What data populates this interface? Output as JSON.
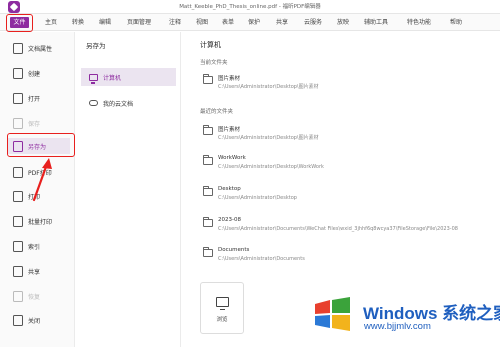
{
  "titlebar": {
    "title": "Matt_Keeble_PhD_Thesis_online.pdf - 福昕PDF编辑器"
  },
  "menu": {
    "file": "文件",
    "items": [
      "主页",
      "转换",
      "编辑",
      "页面管理",
      "注释",
      "视图",
      "表单",
      "保护",
      "共享",
      "云服务",
      "放映",
      "辅助工具",
      "特色功能",
      "帮助"
    ]
  },
  "sidebar": {
    "items": [
      {
        "label": "文档属性"
      },
      {
        "label": "创建"
      },
      {
        "label": "打开"
      },
      {
        "label": "保存"
      },
      {
        "label": "另存为"
      },
      {
        "label": "PDF打印"
      },
      {
        "label": "打印"
      },
      {
        "label": "批量打印"
      },
      {
        "label": "索引"
      },
      {
        "label": "共享"
      },
      {
        "label": "恢复"
      },
      {
        "label": "关闭"
      }
    ]
  },
  "middle": {
    "title": "另存为",
    "options": [
      {
        "label": "计算机"
      },
      {
        "label": "我的云文档"
      }
    ]
  },
  "content": {
    "title": "计算机",
    "current_folder_label": "当前文件夹",
    "recent_folder_label": "最近的文件夹",
    "current_folder": {
      "name": "图片素材",
      "path": "C:\\Users\\Administrator\\Desktop\\图片素材"
    },
    "recent_folders": [
      {
        "name": "图片素材",
        "path": "C:\\Users\\Administrator\\Desktop\\图片素材"
      },
      {
        "name": "WorkWork",
        "path": "C:\\Users\\Administrator\\Desktop\\WorkWork"
      },
      {
        "name": "Desktop",
        "path": "C:\\Users\\Administrator\\Desktop"
      },
      {
        "name": "2023-08",
        "path": "C:\\Users\\Administrator\\Documents\\WeChat Files\\wxid_3jhhf6q8wcya37\\FileStorage\\File\\2023-08"
      },
      {
        "name": "Documents",
        "path": "C:\\Users\\Administrator\\Documents"
      }
    ],
    "browse_label": "浏览"
  },
  "watermark": {
    "title": "Windows 系统之家",
    "url": "www.bjjmlv.com"
  },
  "colors": {
    "accent": "#8e2ca0",
    "highlight": "#e8201e",
    "watermark": "#1f5fbf"
  }
}
